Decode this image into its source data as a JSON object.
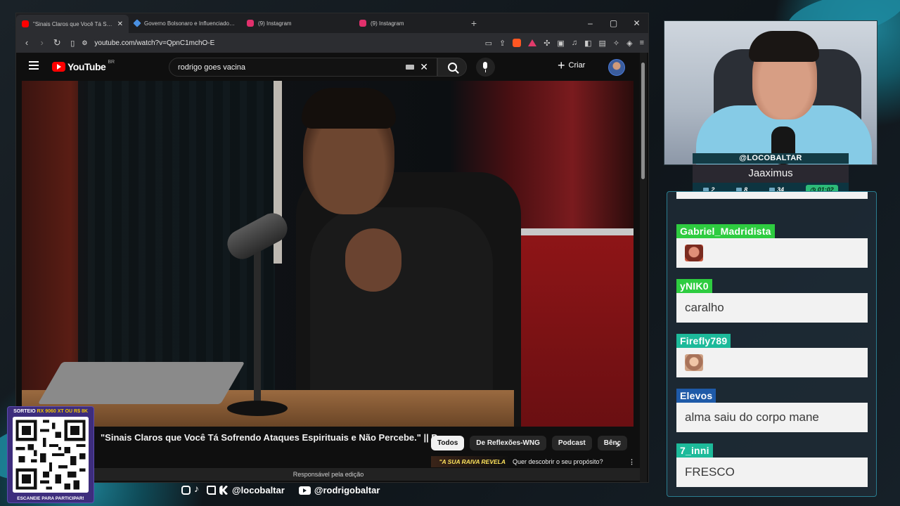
{
  "browser": {
    "tabs": [
      {
        "title": "\"Sinais Claros que Você Tá Sofrendo Ataques Espirituais e Não Percebe.\" || Pr.",
        "favicon_color": "#ff0000",
        "active": true
      },
      {
        "title": "Governo Bolsonaro e Influenciadores Pagos",
        "favicon_color": "#4a90e2",
        "active": false
      },
      {
        "title": "(9) Instagram",
        "favicon_color": "#e1306c",
        "active": false
      },
      {
        "title": "(9) Instagram",
        "favicon_color": "#e1306c",
        "active": false
      }
    ],
    "new_tab": "+",
    "window_controls": {
      "minimize": "–",
      "maximize": "▢",
      "close": "✕"
    },
    "url": "youtube.com/watch?v=QpnC1mchO-E"
  },
  "youtube": {
    "logo_text": "YouTube",
    "country": "BR",
    "search_query": "rodrigo goes vacina",
    "create_label": "Criar",
    "video_title": "\"Sinais Claros que Você Tá Sofrendo Ataques Espirituais e Não Percebe.\" || Pr.",
    "chips": [
      "Todos",
      "De Reflexões-WNG",
      "Podcast",
      "Bênç"
    ],
    "recommendation": {
      "thumb_text": "\"A SUA RAIVA REVELA",
      "title": "Quer descobrir o seu propósito?"
    },
    "edit_notice": "Responsável pela edição"
  },
  "webcam": {
    "streamer": "@LOCOBALTAR",
    "game": "Jaaximus",
    "stats": {
      "chat": "2",
      "videos": "8",
      "viewers": "34",
      "timer": "01:02"
    }
  },
  "chat": {
    "messages": [
      {
        "user": "Gabriel_Madridista",
        "color": "#2ecc40",
        "text": "",
        "emote": "a"
      },
      {
        "user": "yNIK0",
        "color": "#2ecc40",
        "text": "caralho",
        "emote": ""
      },
      {
        "user": "Firefly789",
        "color": "#1dba9a",
        "text": "",
        "emote": "b"
      },
      {
        "user": "Elevos",
        "color": "#1e5aa8",
        "text": "alma saiu do corpo mane",
        "emote": ""
      },
      {
        "user": "7_inni",
        "color": "#1dba9a",
        "text": "FRESCO",
        "emote": ""
      }
    ]
  },
  "overlay": {
    "giveaway_prefix": "SORTEIO ",
    "giveaway_prize": "RX 9060 XT OU R$ 8K",
    "scan_text": "ESCANEIE PARA PARTICIPAR!",
    "socials": {
      "main": "@locobaltar",
      "youtube": "@rodrigobaltar"
    }
  }
}
